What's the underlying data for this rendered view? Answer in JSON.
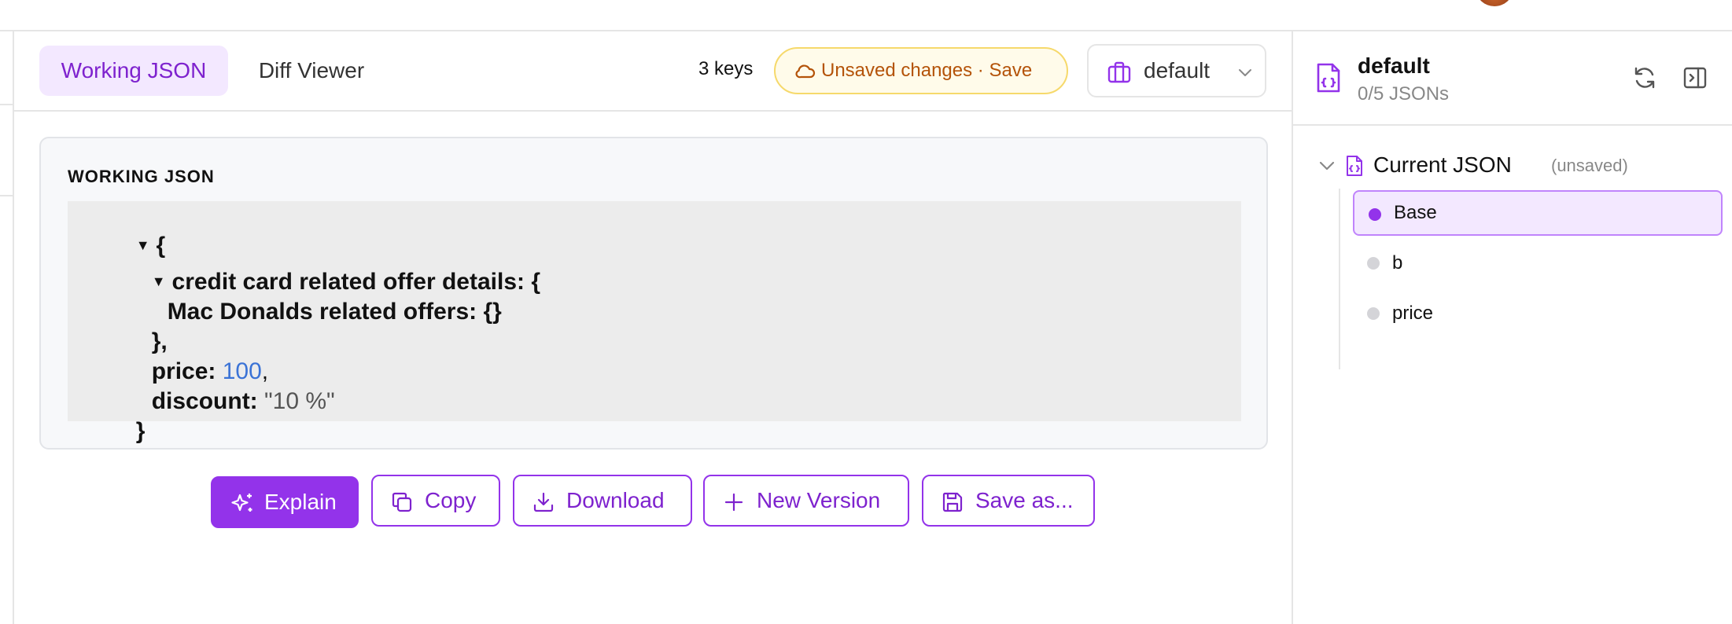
{
  "toolbar": {
    "tabs": [
      {
        "label": "Working JSON",
        "active": true
      },
      {
        "label": "Diff Viewer",
        "active": false
      }
    ],
    "key_count": "3 keys",
    "unsaved_label": "Unsaved changes · Save",
    "profile_select": "default"
  },
  "json_card": {
    "title": "WORKING JSON",
    "lines": {
      "open_brace": "{",
      "credit_key": "credit card related offer details: {",
      "mac_key": "Mac Donalds related offers: {}",
      "credit_close": "},",
      "price_key": "price:",
      "price_value": "100",
      "price_comma": ",",
      "discount_key": "discount:",
      "discount_value": "\"10 %\"",
      "close_brace": "}"
    }
  },
  "actions": {
    "explain": "Explain",
    "copy": "Copy",
    "download": "Download",
    "new_version": "New Version",
    "save_as": "Save as..."
  },
  "sidebar": {
    "title": "default",
    "subtitle": "0/5 JSONs",
    "tree_root": "Current JSON",
    "tree_root_tag": "(unsaved)",
    "nodes": [
      {
        "label": "Base",
        "active": true
      },
      {
        "label": "b",
        "active": false
      },
      {
        "label": "price",
        "active": false
      }
    ]
  },
  "colors": {
    "accent": "#9333ea",
    "accent_light": "#f3e8ff",
    "warning_text": "#b45309",
    "number": "#3b73d6"
  }
}
